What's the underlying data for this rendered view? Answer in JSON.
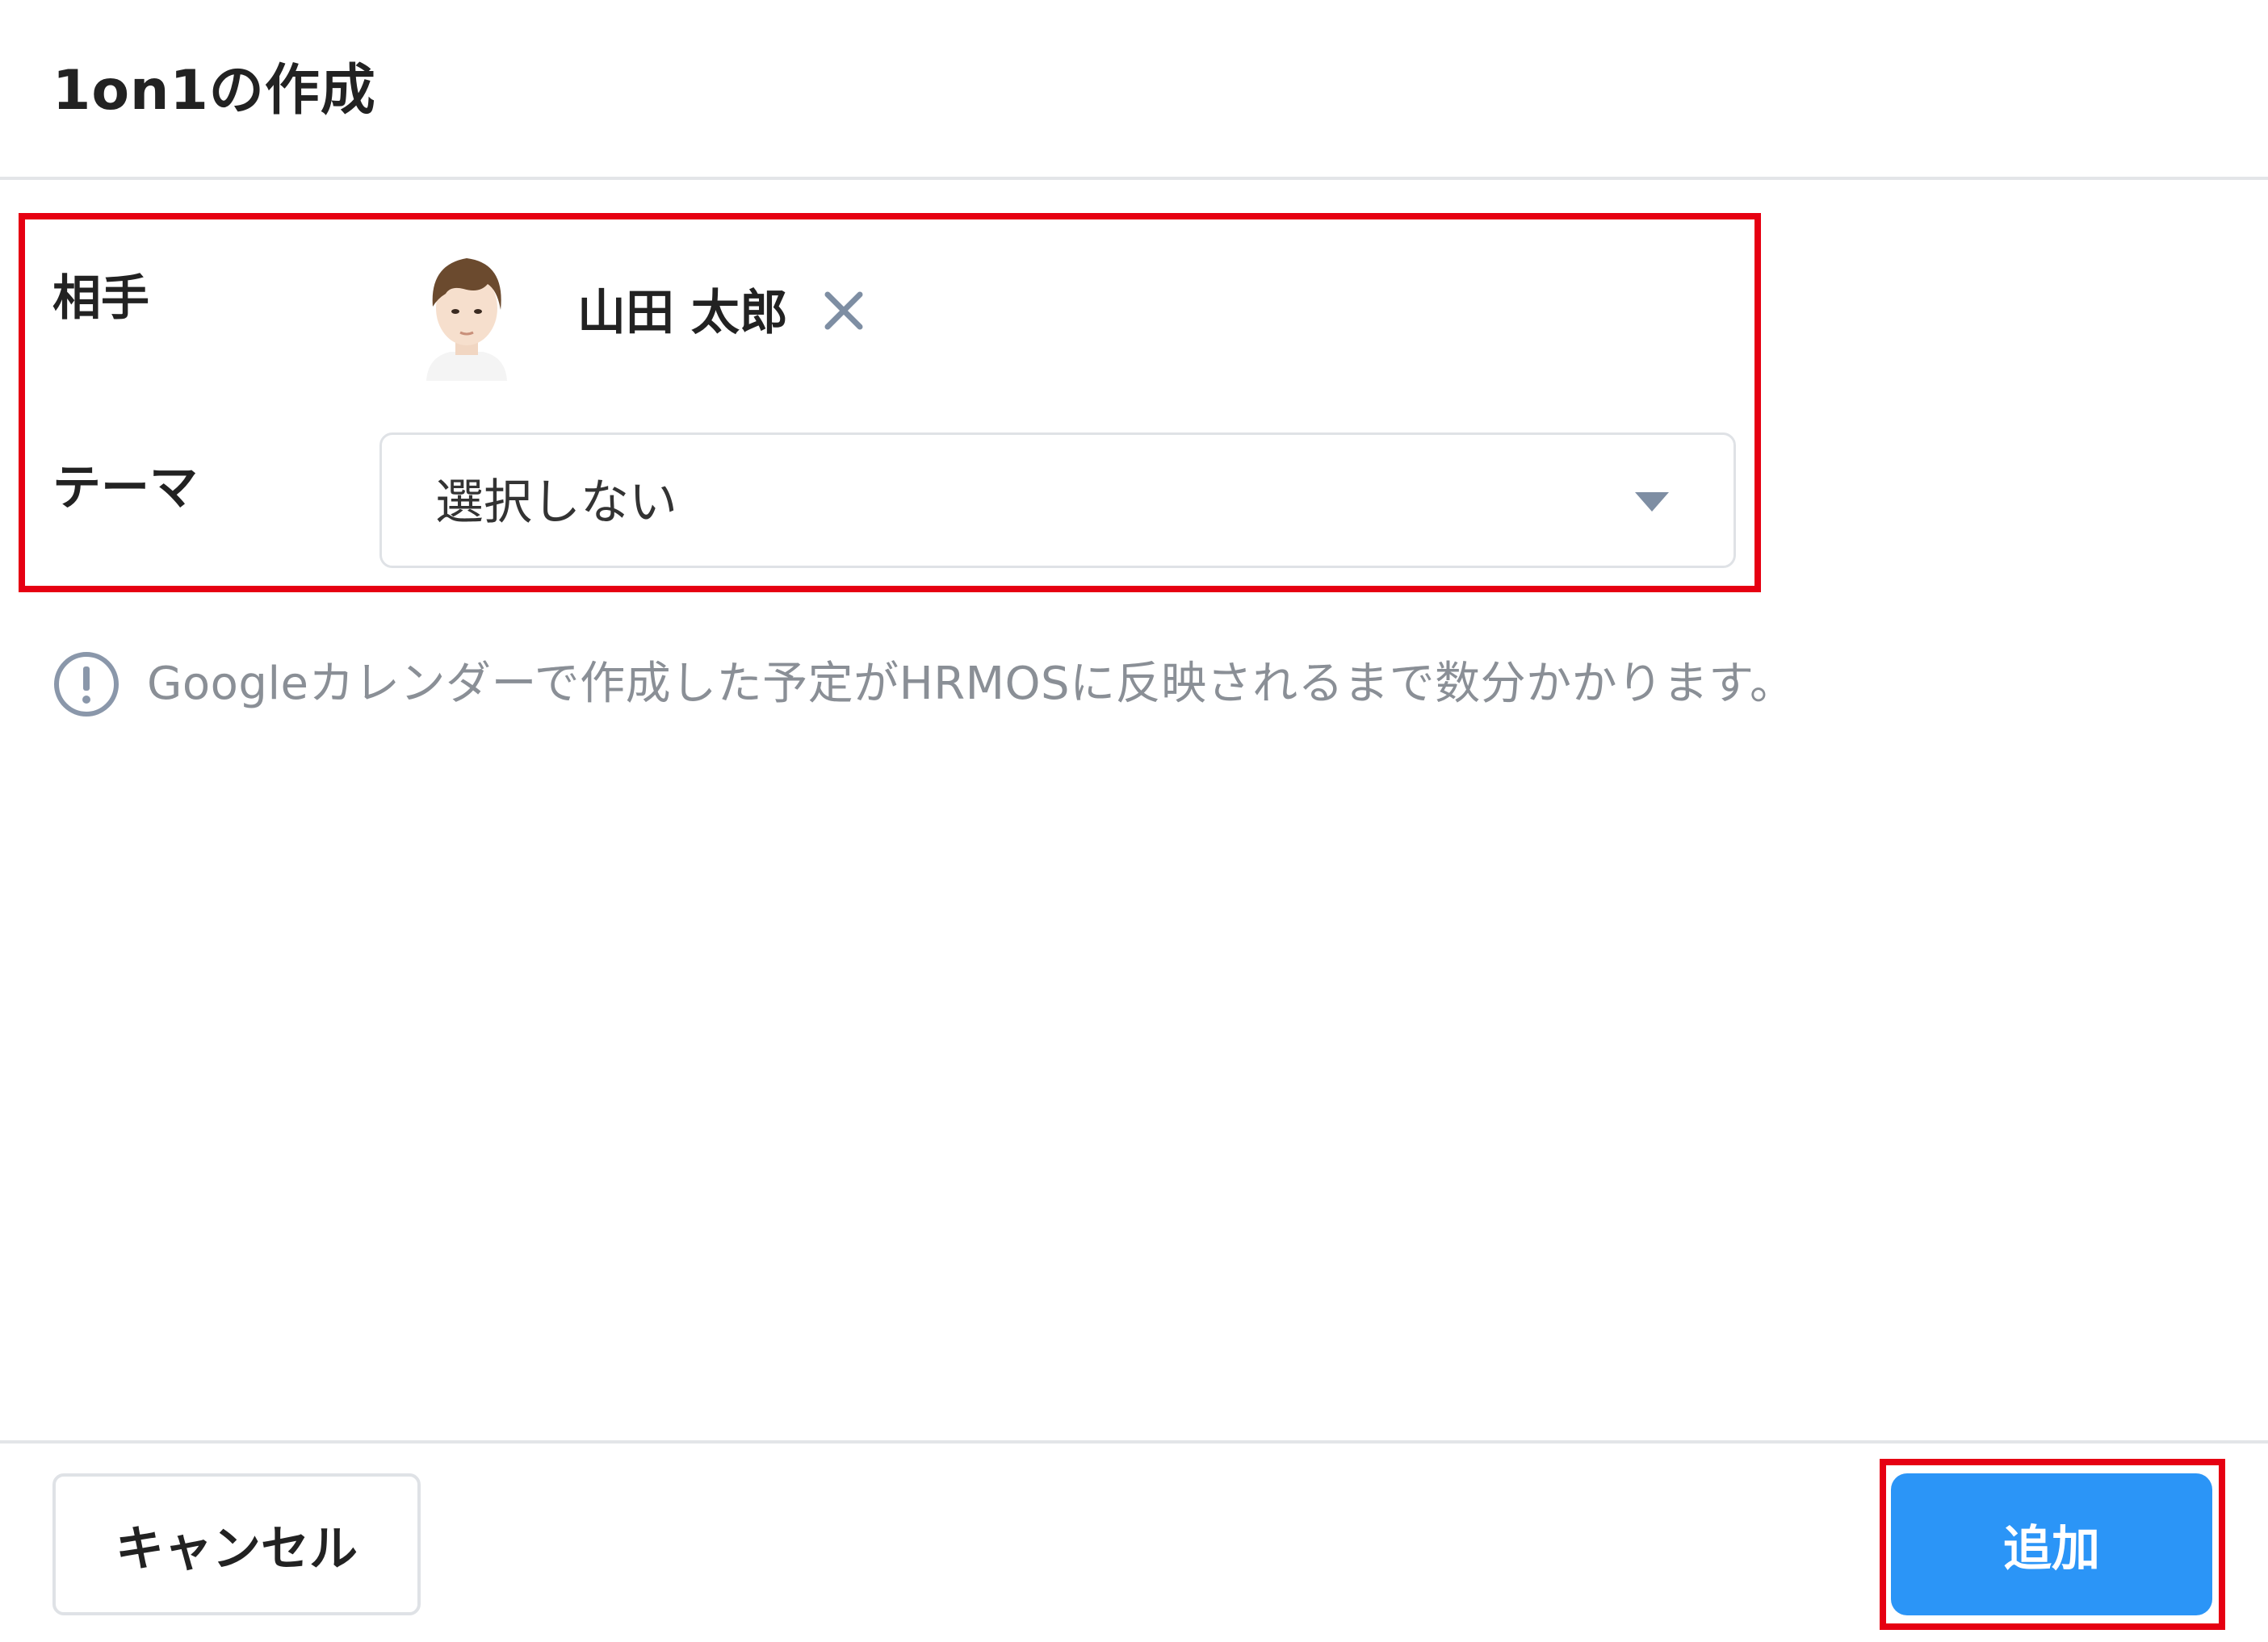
{
  "dialog": {
    "title": "1on1の作成"
  },
  "form": {
    "partner_label": "相手",
    "partner_name": "山田 太郎",
    "theme_label": "テーマ",
    "theme_select": {
      "selected": "選択しない"
    }
  },
  "notice": {
    "text": "Googleカレンダーで作成した予定がHRMOSに反映されるまで数分かかります。"
  },
  "footer": {
    "cancel_label": "キャンセル",
    "add_label": "追加"
  },
  "colors": {
    "primary_button": "#2b95f7",
    "highlight": "#e60012",
    "muted_text": "#8a8f96",
    "icon": "#7e8ea3"
  },
  "icons": {
    "remove": "close-icon",
    "caret": "chevron-down-icon",
    "notice": "info-circle-icon"
  }
}
